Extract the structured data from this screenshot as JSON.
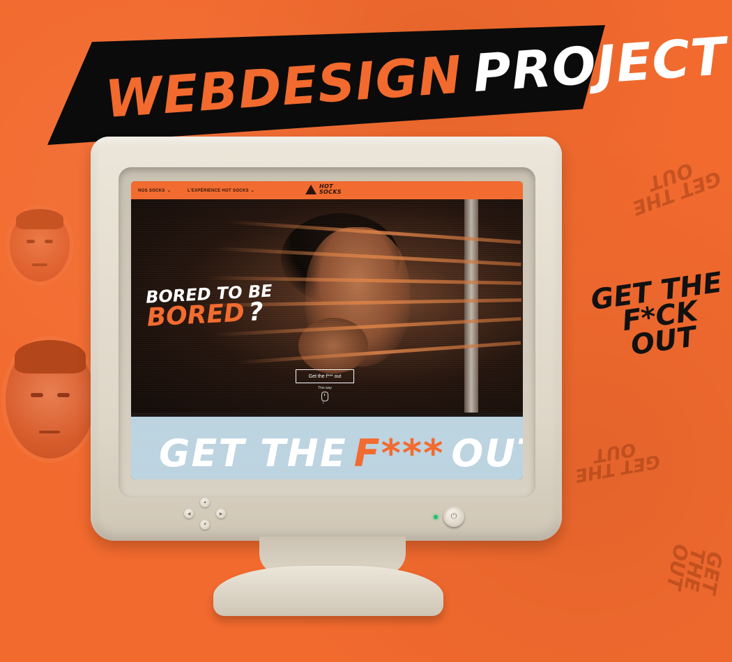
{
  "banner": {
    "word1": "WEBDESIGN",
    "word2": "PROJECT"
  },
  "website": {
    "nav": [
      {
        "label": "NOS SOCKS",
        "icon": "chevron-down-icon"
      },
      {
        "label": "L'EXPÉRIENCE HOT SOCKS",
        "icon": "chevron-down-icon"
      }
    ],
    "logo_line1": "HOT",
    "logo_line2": "SOCKS",
    "hero": {
      "line1": "BORED TO BE",
      "line2": "BORED",
      "question_mark": "?",
      "cta": "Get the f*** out",
      "scroll_hint": "This way"
    },
    "section2": {
      "word1": "GET THE",
      "word2": "F***",
      "word3": "OUT"
    }
  },
  "sticker": {
    "line1": "GET THE",
    "line2": "F*CK",
    "line3": "OUT"
  },
  "colors": {
    "accent": "#f26a2e",
    "banner_bg": "#0b0b0b",
    "monitor": "#e6dfd2",
    "led": "#23c06b"
  }
}
